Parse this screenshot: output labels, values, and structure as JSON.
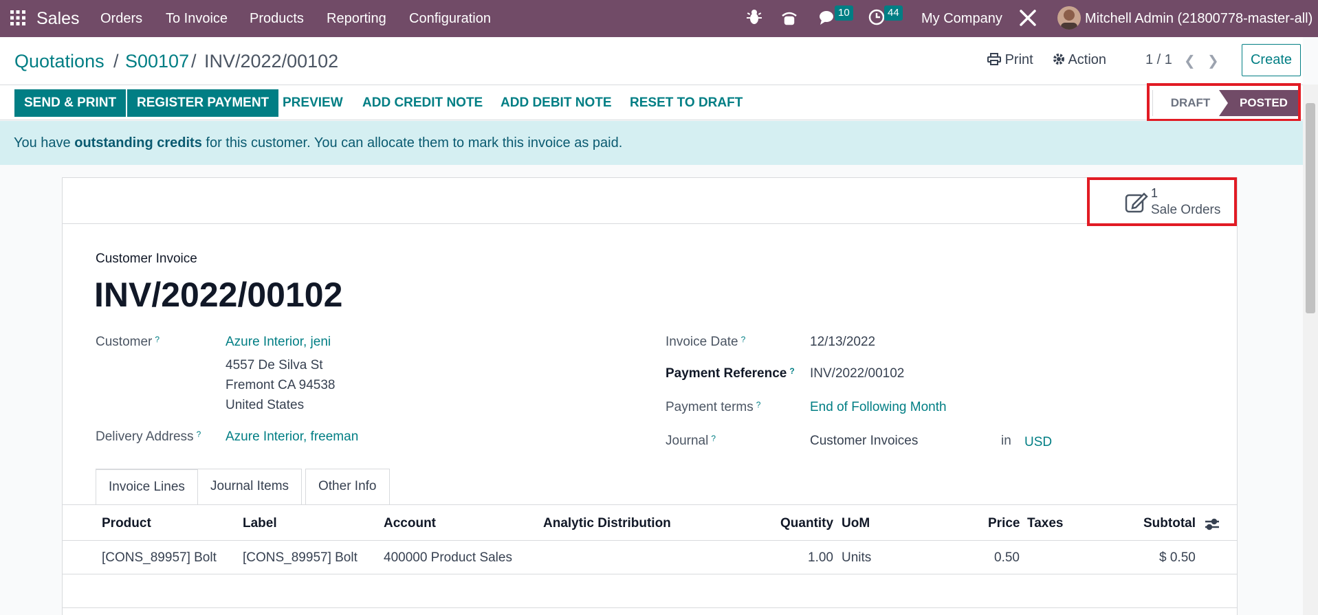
{
  "navbar": {
    "app_name": "Sales",
    "menu": [
      "Orders",
      "To Invoice",
      "Products",
      "Reporting",
      "Configuration"
    ],
    "messages_count": "10",
    "activities_count": "44",
    "company": "My Company",
    "user": "Mitchell Admin (21800778-master-all)"
  },
  "breadcrumb": {
    "items": [
      "Quotations",
      "S00107"
    ],
    "current": "INV/2022/00102",
    "separator": "/"
  },
  "control": {
    "print": "Print",
    "action": "Action",
    "pager": "1 / 1",
    "create": "Create"
  },
  "statusbar": {
    "buttons": [
      "SEND & PRINT",
      "REGISTER PAYMENT",
      "PREVIEW",
      "ADD CREDIT NOTE",
      "ADD DEBIT NOTE",
      "RESET TO DRAFT"
    ],
    "stages": [
      "DRAFT",
      "POSTED"
    ],
    "active_stage": "POSTED"
  },
  "alert": {
    "prefix": "You have",
    "bold": "outstanding credits",
    "suffix": "for this customer. You can allocate them to mark this invoice as paid."
  },
  "smart_button": {
    "count": "1",
    "label": "Sale Orders"
  },
  "invoice": {
    "type_label": "Customer Invoice",
    "number": "INV/2022/00102",
    "customer_label": "Customer",
    "customer": "Azure Interior, jeni",
    "address": [
      "4557 De Silva St",
      "Fremont CA 94538",
      "United States"
    ],
    "delivery_label": "Delivery Address",
    "delivery": "Azure Interior, freeman",
    "invoice_date_label": "Invoice Date",
    "invoice_date": "12/13/2022",
    "payment_ref_label": "Payment Reference",
    "payment_ref": "INV/2022/00102",
    "payment_terms_label": "Payment terms",
    "payment_terms": "End of Following Month",
    "journal_label": "Journal",
    "journal": "Customer Invoices",
    "in_label": "in",
    "currency": "USD",
    "help_mark": "?"
  },
  "tabs": [
    "Invoice Lines",
    "Journal Items",
    "Other Info"
  ],
  "lines": {
    "headers": {
      "product": "Product",
      "label": "Label",
      "account": "Account",
      "analytic": "Analytic Distribution",
      "quantity": "Quantity",
      "uom": "UoM",
      "price": "Price",
      "taxes": "Taxes",
      "subtotal": "Subtotal"
    },
    "rows": [
      {
        "product": "[CONS_89957] Bolt",
        "label": "[CONS_89957] Bolt",
        "account": "400000 Product Sales",
        "analytic": "",
        "quantity": "1.00",
        "uom": "Units",
        "price": "0.50",
        "taxes": "",
        "subtotal": "$ 0.50"
      }
    ]
  },
  "colors": {
    "brand": "#714b67",
    "accent": "#017e84",
    "highlight": "#e11b24"
  }
}
